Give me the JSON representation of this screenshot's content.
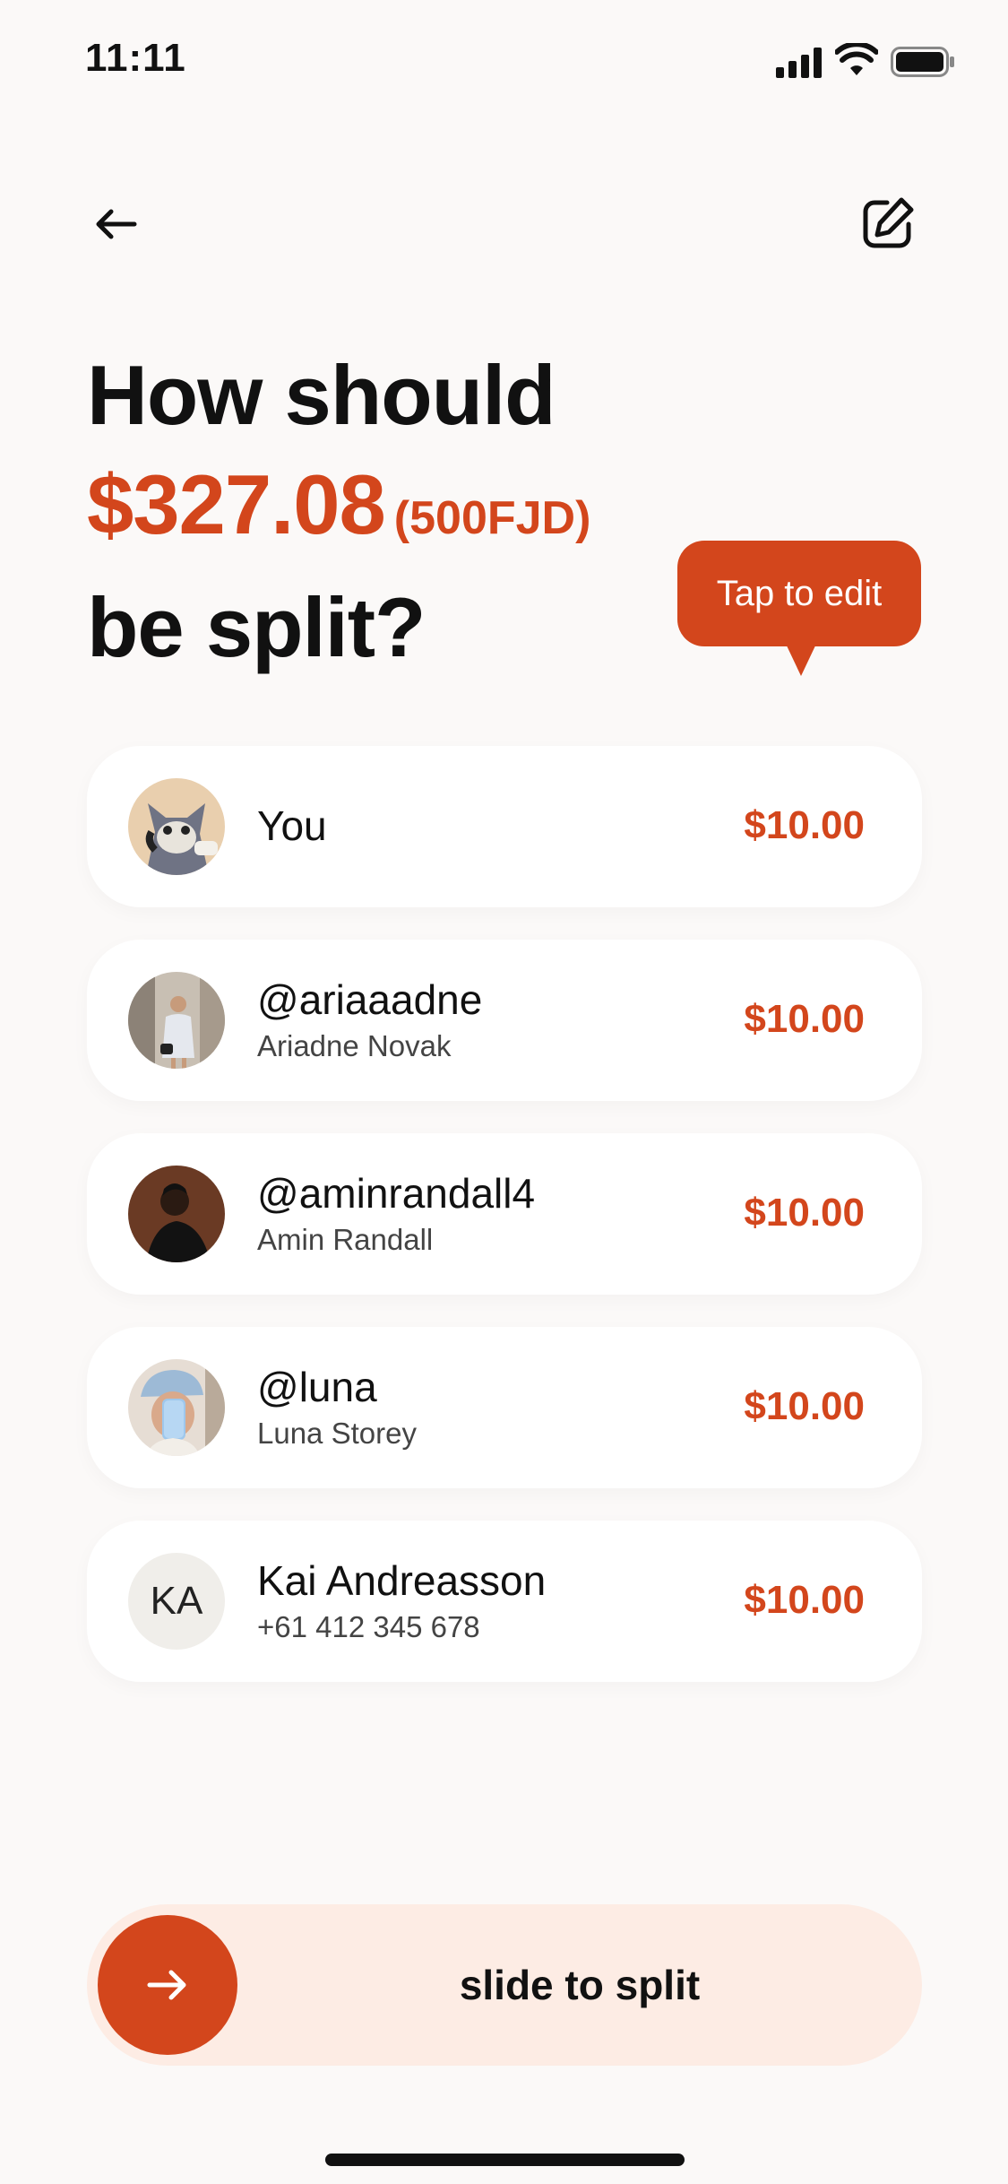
{
  "status_bar": {
    "time": "11:11"
  },
  "headline": {
    "line1": "How should",
    "amount": "$327.08",
    "foreign_amount": "(500FJD)",
    "line3": "be split?"
  },
  "tooltip": {
    "text": "Tap to edit"
  },
  "participants": [
    {
      "name": "You",
      "subtitle": "",
      "amount": "$10.00",
      "avatar": "cartoon-avatar"
    },
    {
      "name": "@ariaaadne",
      "subtitle": "Ariadne Novak",
      "amount": "$10.00",
      "avatar": "photo-avatar"
    },
    {
      "name": "@aminrandall4",
      "subtitle": "Amin Randall",
      "amount": "$10.00",
      "avatar": "photo-avatar"
    },
    {
      "name": "@luna",
      "subtitle": "Luna Storey",
      "amount": "$10.00",
      "avatar": "photo-avatar"
    },
    {
      "name": "Kai Andreasson",
      "subtitle": "+61 412 345 678",
      "amount": "$10.00",
      "avatar": "initials",
      "initials": "KA"
    }
  ],
  "slider": {
    "label": "slide to split"
  },
  "colors": {
    "accent": "#d3461c",
    "background": "#fbf9f8",
    "slider_bg": "#fdece4"
  },
  "icons": [
    "back-arrow-icon",
    "edit-icon",
    "arrow-right-icon",
    "signal-icon",
    "wifi-icon",
    "battery-icon"
  ]
}
